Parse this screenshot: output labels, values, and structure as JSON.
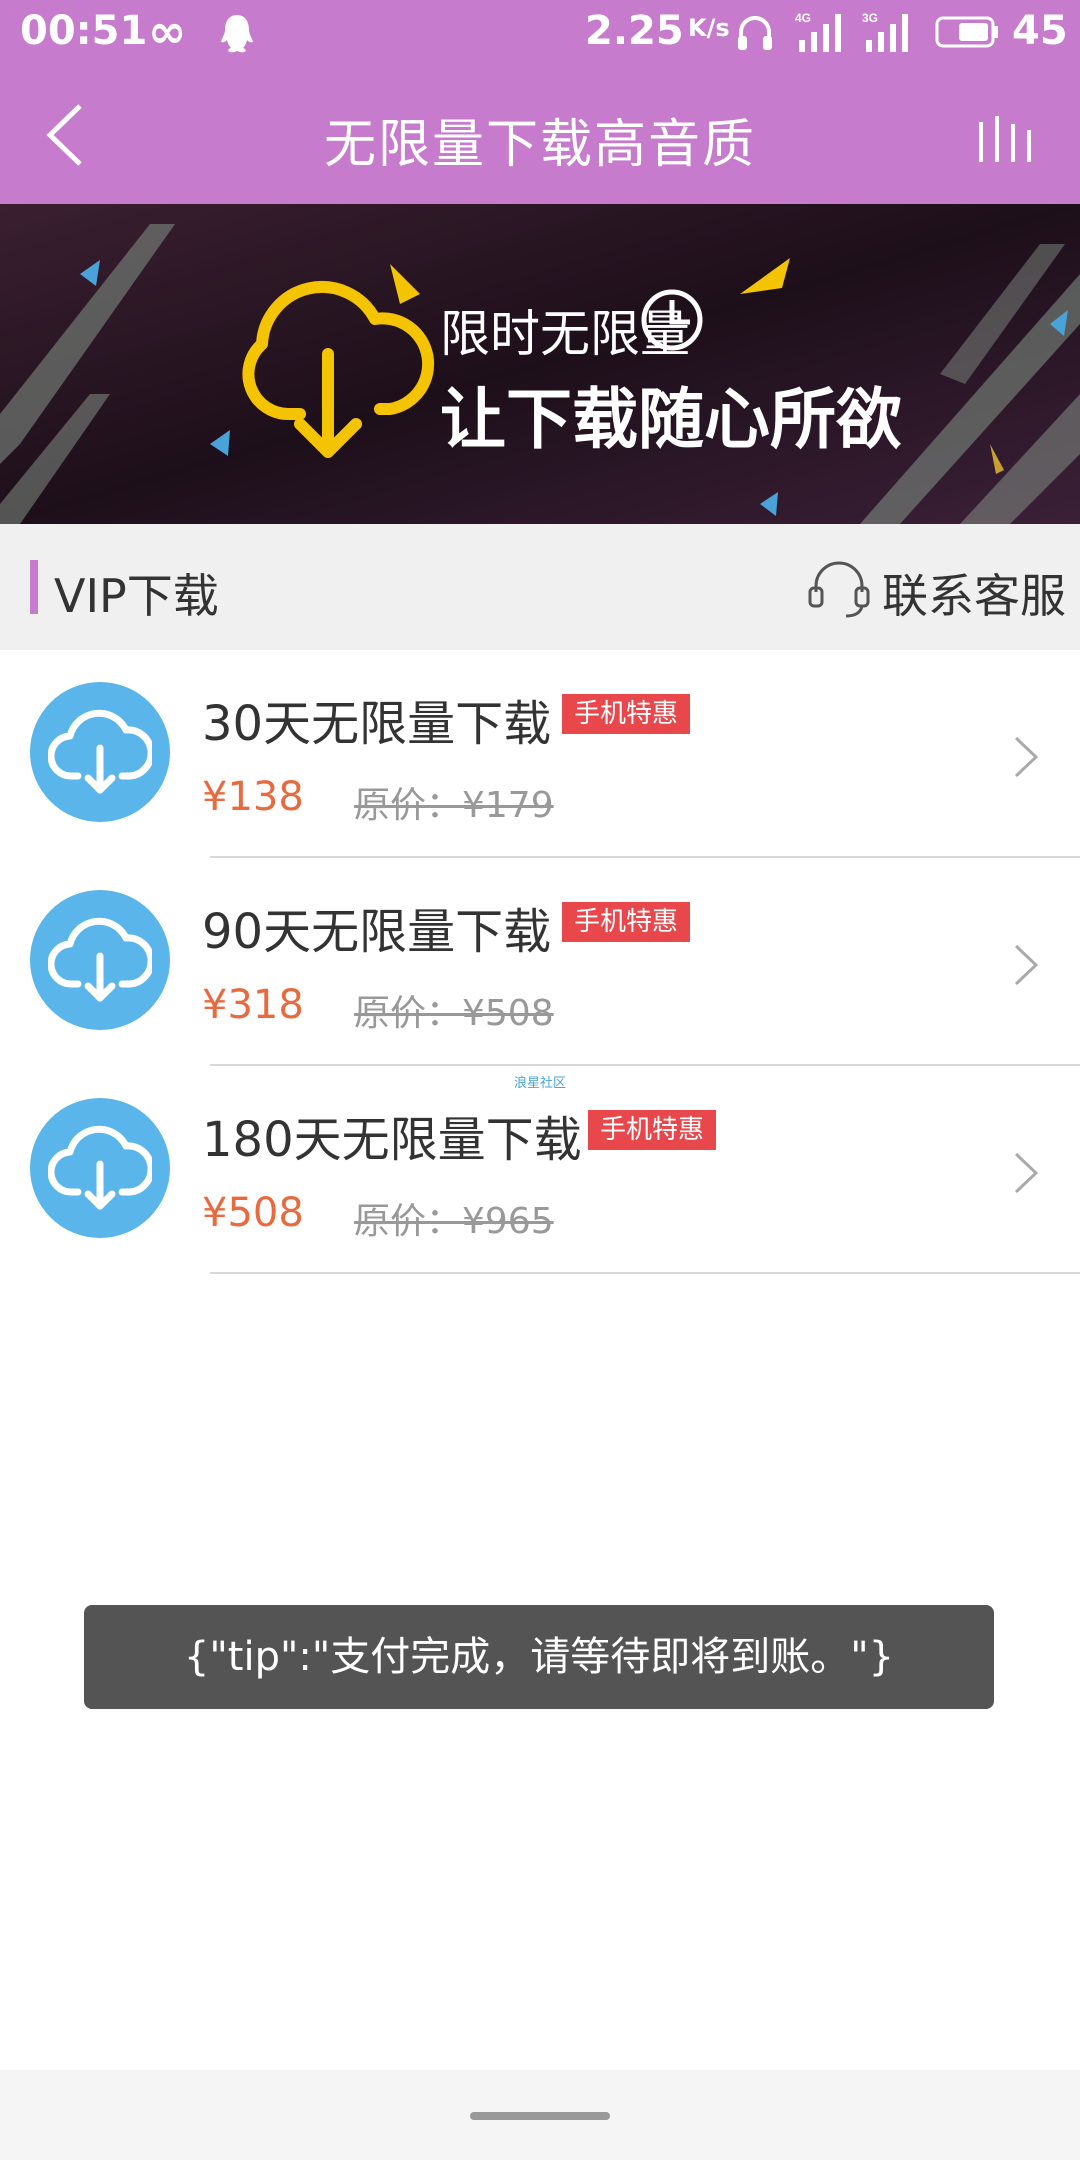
{
  "status_bar": {
    "time": "00:51",
    "infinity": "∞",
    "speed": "2.25",
    "speed_unit": "K/s",
    "battery_level": "45",
    "icons": [
      "qq-icon",
      "headset-icon",
      "signal-4g-icon",
      "signal-3g-icon",
      "battery-icon"
    ]
  },
  "title_bar": {
    "title": "无限量下载高音质",
    "back_icon": "chevron-left-icon",
    "menu_icon": "bars-icon"
  },
  "banner": {
    "line1": "限时无限量",
    "line2": "让下载随心所欲",
    "icon": "cloud-download-icon"
  },
  "section": {
    "label": "VIP下载",
    "service_label": "联系客服",
    "service_icon": "headset-icon"
  },
  "packages": [
    {
      "name": "30天无限量下载",
      "badge": "手机特惠",
      "price": "¥138",
      "original": "原价：¥179"
    },
    {
      "name": "90天无限量下载",
      "badge": "手机特惠",
      "price": "¥318",
      "original": "原价：¥508"
    },
    {
      "name": "180天无限量下载",
      "badge": "手机特惠",
      "price": "¥508",
      "original": "原价：¥965"
    }
  ],
  "watermark": "浪星社区",
  "toast": "{\"tip\":\"支付完成，请等待即将到账。\"}",
  "colors": {
    "header": "#c77bcc",
    "accent_price": "#e96a3e",
    "badge": "#e8474b",
    "icon_circle": "#5ab5ea",
    "toast_bg": "#545454"
  }
}
